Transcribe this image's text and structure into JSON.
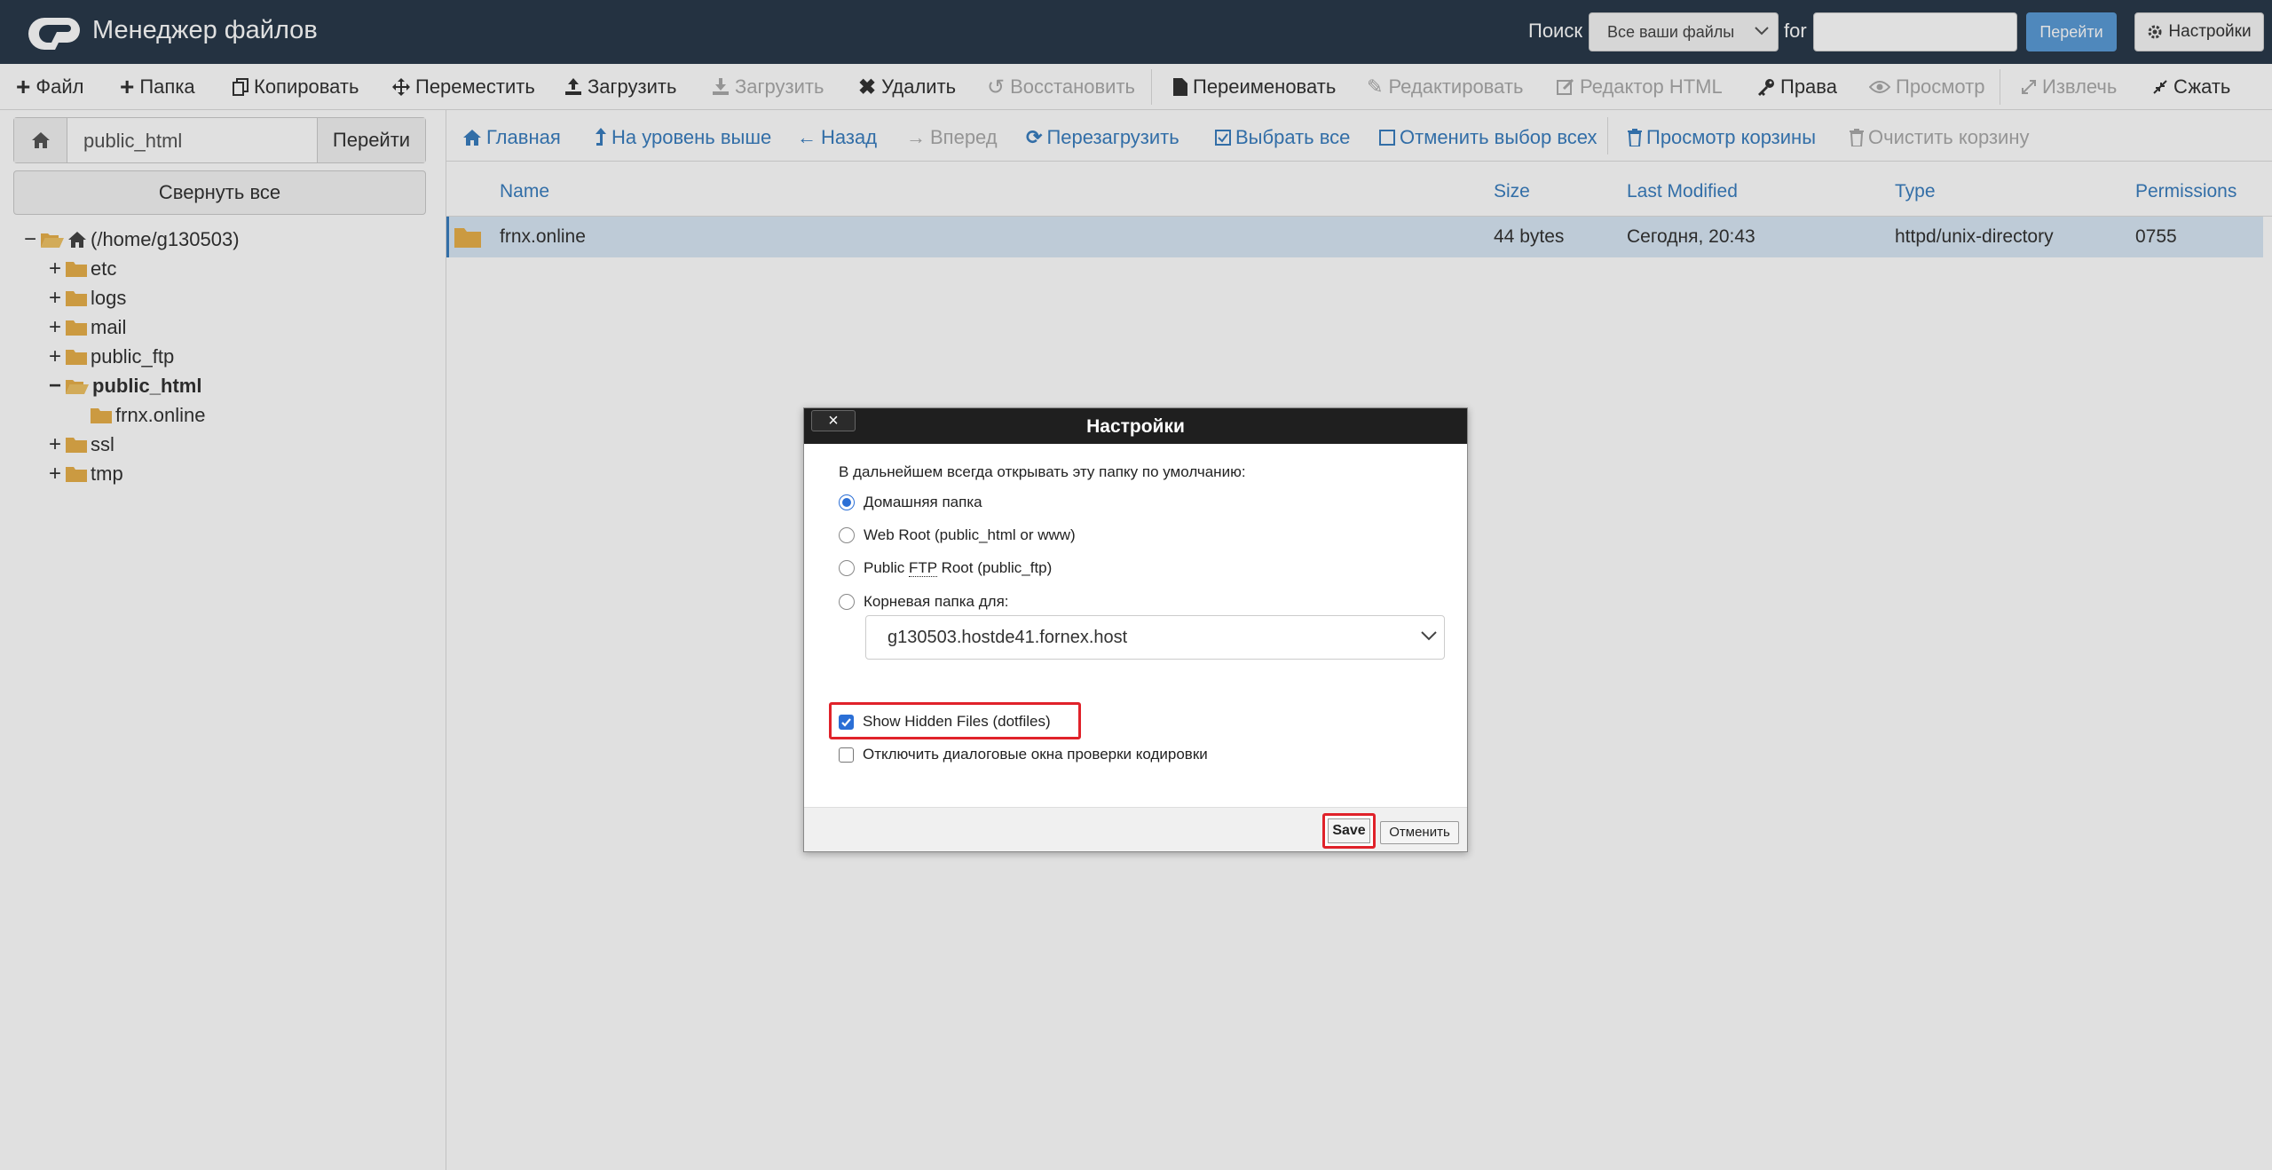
{
  "header": {
    "app_title": "Менеджер файлов",
    "search_label": "Поиск",
    "search_scope": "Все ваши файлы",
    "for_label": "for",
    "search_value": "",
    "go_label": "Перейти",
    "settings_label": "Настройки"
  },
  "toolbar": {
    "file": "Файл",
    "folder": "Папка",
    "copy": "Копировать",
    "move": "Переместить",
    "upload": "Загрузить",
    "download": "Загрузить",
    "delete": "Удалить",
    "restore": "Восстановить",
    "rename": "Переименовать",
    "edit": "Редактировать",
    "html_editor": "Редактор HTML",
    "permissions": "Права",
    "view": "Просмотр",
    "extract": "Извлечь",
    "compress": "Сжать"
  },
  "left": {
    "path_value": "public_html",
    "go_label": "Перейти",
    "collapse_all": "Свернуть все",
    "root": "(/home/g130503)",
    "tree": [
      "etc",
      "logs",
      "mail",
      "public_ftp",
      "public_html",
      "frnx.online",
      "ssl",
      "tmp"
    ]
  },
  "nav": {
    "home": "Главная",
    "up": "На уровень выше",
    "back": "Назад",
    "forward": "Вперед",
    "reload": "Перезагрузить",
    "select_all": "Выбрать все",
    "deselect_all": "Отменить выбор всех",
    "view_trash": "Просмотр корзины",
    "empty_trash": "Очистить корзину"
  },
  "table": {
    "columns": [
      "Name",
      "Size",
      "Last Modified",
      "Type",
      "Permissions"
    ],
    "rows": [
      {
        "name": "frnx.online",
        "size": "44 bytes",
        "modified": "Сегодня, 20:43",
        "type": "httpd/unix-directory",
        "perms": "0755"
      }
    ]
  },
  "dialog": {
    "close": "×",
    "title": "Настройки",
    "intro": "В дальнейшем всегда открывать эту папку по умолчанию:",
    "opt_home": "Домашняя папка",
    "opt_webroot": "Web Root (public_html or www)",
    "opt_ftp_prefix": "Public ",
    "opt_ftp_abbr": "FTP",
    "opt_ftp_suffix": " Root (public_ftp)",
    "opt_domain": "Корневая папка для:",
    "domain_value": "g130503.hostde41.fornex.host",
    "show_hidden": "Show Hidden Files (dotfiles)",
    "disable_encoding": "Отключить диалоговые окна проверки кодировки",
    "save": "Save",
    "cancel": "Отменить"
  },
  "colors": {
    "header_bg": "#293a4a",
    "link": "#3a7ebf",
    "highlight": "#e0222a",
    "folder": "#e8b04a",
    "selected_row": "#d9e8f5"
  }
}
